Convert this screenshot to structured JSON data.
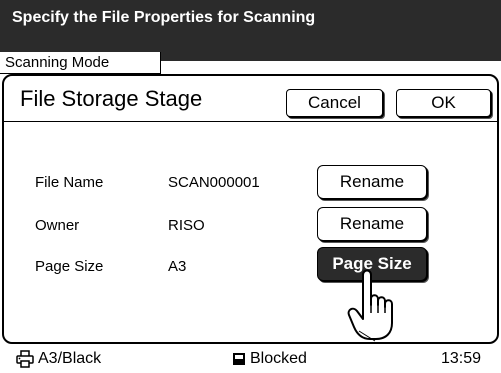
{
  "header": {
    "title": "Specify the File Properties for Scanning"
  },
  "mode_tab": {
    "label": "Scanning Mode"
  },
  "dialog": {
    "title": "File Storage Stage",
    "cancel_label": "Cancel",
    "ok_label": "OK",
    "rows": [
      {
        "label": "File Name",
        "value": "SCAN000001",
        "button": "Rename"
      },
      {
        "label": "Owner",
        "value": "RISO",
        "button": "Rename"
      },
      {
        "label": "Page Size",
        "value": "A3",
        "button": "Page Size"
      }
    ]
  },
  "status": {
    "paper": "A3/Black",
    "paper_icon": "printer-icon",
    "state": "Blocked",
    "state_icon": "document-icon",
    "time": "13:59"
  }
}
